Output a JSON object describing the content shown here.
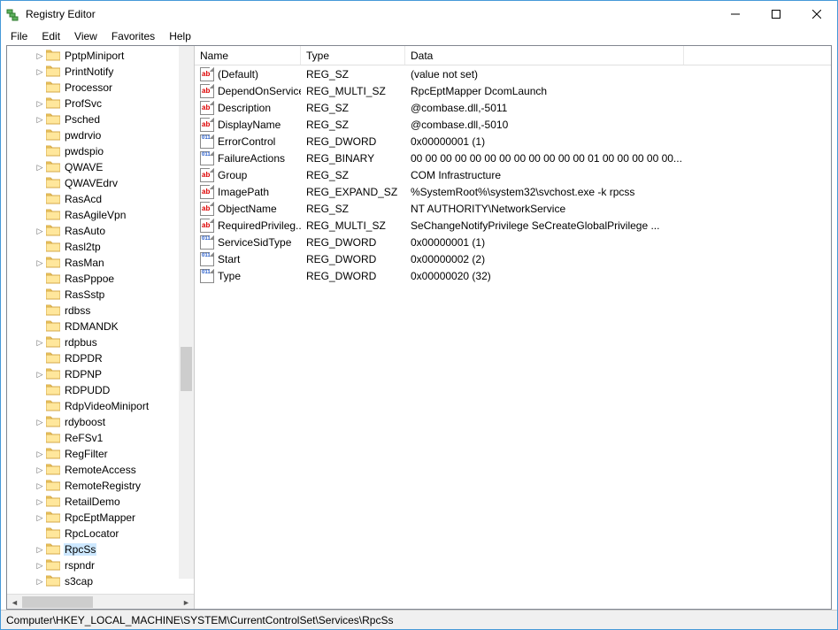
{
  "window": {
    "title": "Registry Editor"
  },
  "menu": {
    "items": [
      "File",
      "Edit",
      "View",
      "Favorites",
      "Help"
    ]
  },
  "tree": {
    "items": [
      {
        "label": "PptpMiniport",
        "expander": ">"
      },
      {
        "label": "PrintNotify",
        "expander": ">"
      },
      {
        "label": "Processor",
        "expander": ""
      },
      {
        "label": "ProfSvc",
        "expander": ">"
      },
      {
        "label": "Psched",
        "expander": ">"
      },
      {
        "label": "pwdrvio",
        "expander": ""
      },
      {
        "label": "pwdspio",
        "expander": ""
      },
      {
        "label": "QWAVE",
        "expander": ">"
      },
      {
        "label": "QWAVEdrv",
        "expander": ""
      },
      {
        "label": "RasAcd",
        "expander": ""
      },
      {
        "label": "RasAgileVpn",
        "expander": ""
      },
      {
        "label": "RasAuto",
        "expander": ">"
      },
      {
        "label": "Rasl2tp",
        "expander": ""
      },
      {
        "label": "RasMan",
        "expander": ">"
      },
      {
        "label": "RasPppoe",
        "expander": ""
      },
      {
        "label": "RasSstp",
        "expander": ""
      },
      {
        "label": "rdbss",
        "expander": ""
      },
      {
        "label": "RDMANDK",
        "expander": ""
      },
      {
        "label": "rdpbus",
        "expander": ">"
      },
      {
        "label": "RDPDR",
        "expander": ""
      },
      {
        "label": "RDPNP",
        "expander": ">"
      },
      {
        "label": "RDPUDD",
        "expander": ""
      },
      {
        "label": "RdpVideoMiniport",
        "expander": ""
      },
      {
        "label": "rdyboost",
        "expander": ">"
      },
      {
        "label": "ReFSv1",
        "expander": ""
      },
      {
        "label": "RegFilter",
        "expander": ">"
      },
      {
        "label": "RemoteAccess",
        "expander": ">"
      },
      {
        "label": "RemoteRegistry",
        "expander": ">"
      },
      {
        "label": "RetailDemo",
        "expander": ">"
      },
      {
        "label": "RpcEptMapper",
        "expander": ">"
      },
      {
        "label": "RpcLocator",
        "expander": ""
      },
      {
        "label": "RpcSs",
        "expander": ">",
        "selected": true
      },
      {
        "label": "rspndr",
        "expander": ">"
      },
      {
        "label": "s3cap",
        "expander": ">"
      }
    ]
  },
  "list": {
    "columns": {
      "name": "Name",
      "type": "Type",
      "data": "Data"
    },
    "rows": [
      {
        "icon": "sz",
        "name": "(Default)",
        "type": "REG_SZ",
        "data": "(value not set)"
      },
      {
        "icon": "sz",
        "name": "DependOnService",
        "type": "REG_MULTI_SZ",
        "data": "RpcEptMapper DcomLaunch"
      },
      {
        "icon": "sz",
        "name": "Description",
        "type": "REG_SZ",
        "data": "@combase.dll,-5011"
      },
      {
        "icon": "sz",
        "name": "DisplayName",
        "type": "REG_SZ",
        "data": "@combase.dll,-5010"
      },
      {
        "icon": "bin",
        "name": "ErrorControl",
        "type": "REG_DWORD",
        "data": "0x00000001 (1)"
      },
      {
        "icon": "bin",
        "name": "FailureActions",
        "type": "REG_BINARY",
        "data": "00 00 00 00 00 00 00 00 00 00 00 00 01 00 00 00 00 00..."
      },
      {
        "icon": "sz",
        "name": "Group",
        "type": "REG_SZ",
        "data": "COM Infrastructure"
      },
      {
        "icon": "sz",
        "name": "ImagePath",
        "type": "REG_EXPAND_SZ",
        "data": "%SystemRoot%\\system32\\svchost.exe -k rpcss"
      },
      {
        "icon": "sz",
        "name": "ObjectName",
        "type": "REG_SZ",
        "data": "NT AUTHORITY\\NetworkService"
      },
      {
        "icon": "sz",
        "name": "RequiredPrivileg...",
        "type": "REG_MULTI_SZ",
        "data": "SeChangeNotifyPrivilege SeCreateGlobalPrivilege ..."
      },
      {
        "icon": "bin",
        "name": "ServiceSidType",
        "type": "REG_DWORD",
        "data": "0x00000001 (1)"
      },
      {
        "icon": "bin",
        "name": "Start",
        "type": "REG_DWORD",
        "data": "0x00000002 (2)"
      },
      {
        "icon": "bin",
        "name": "Type",
        "type": "REG_DWORD",
        "data": "0x00000020 (32)"
      }
    ]
  },
  "status": {
    "path": "Computer\\HKEY_LOCAL_MACHINE\\SYSTEM\\CurrentControlSet\\Services\\RpcSs"
  }
}
